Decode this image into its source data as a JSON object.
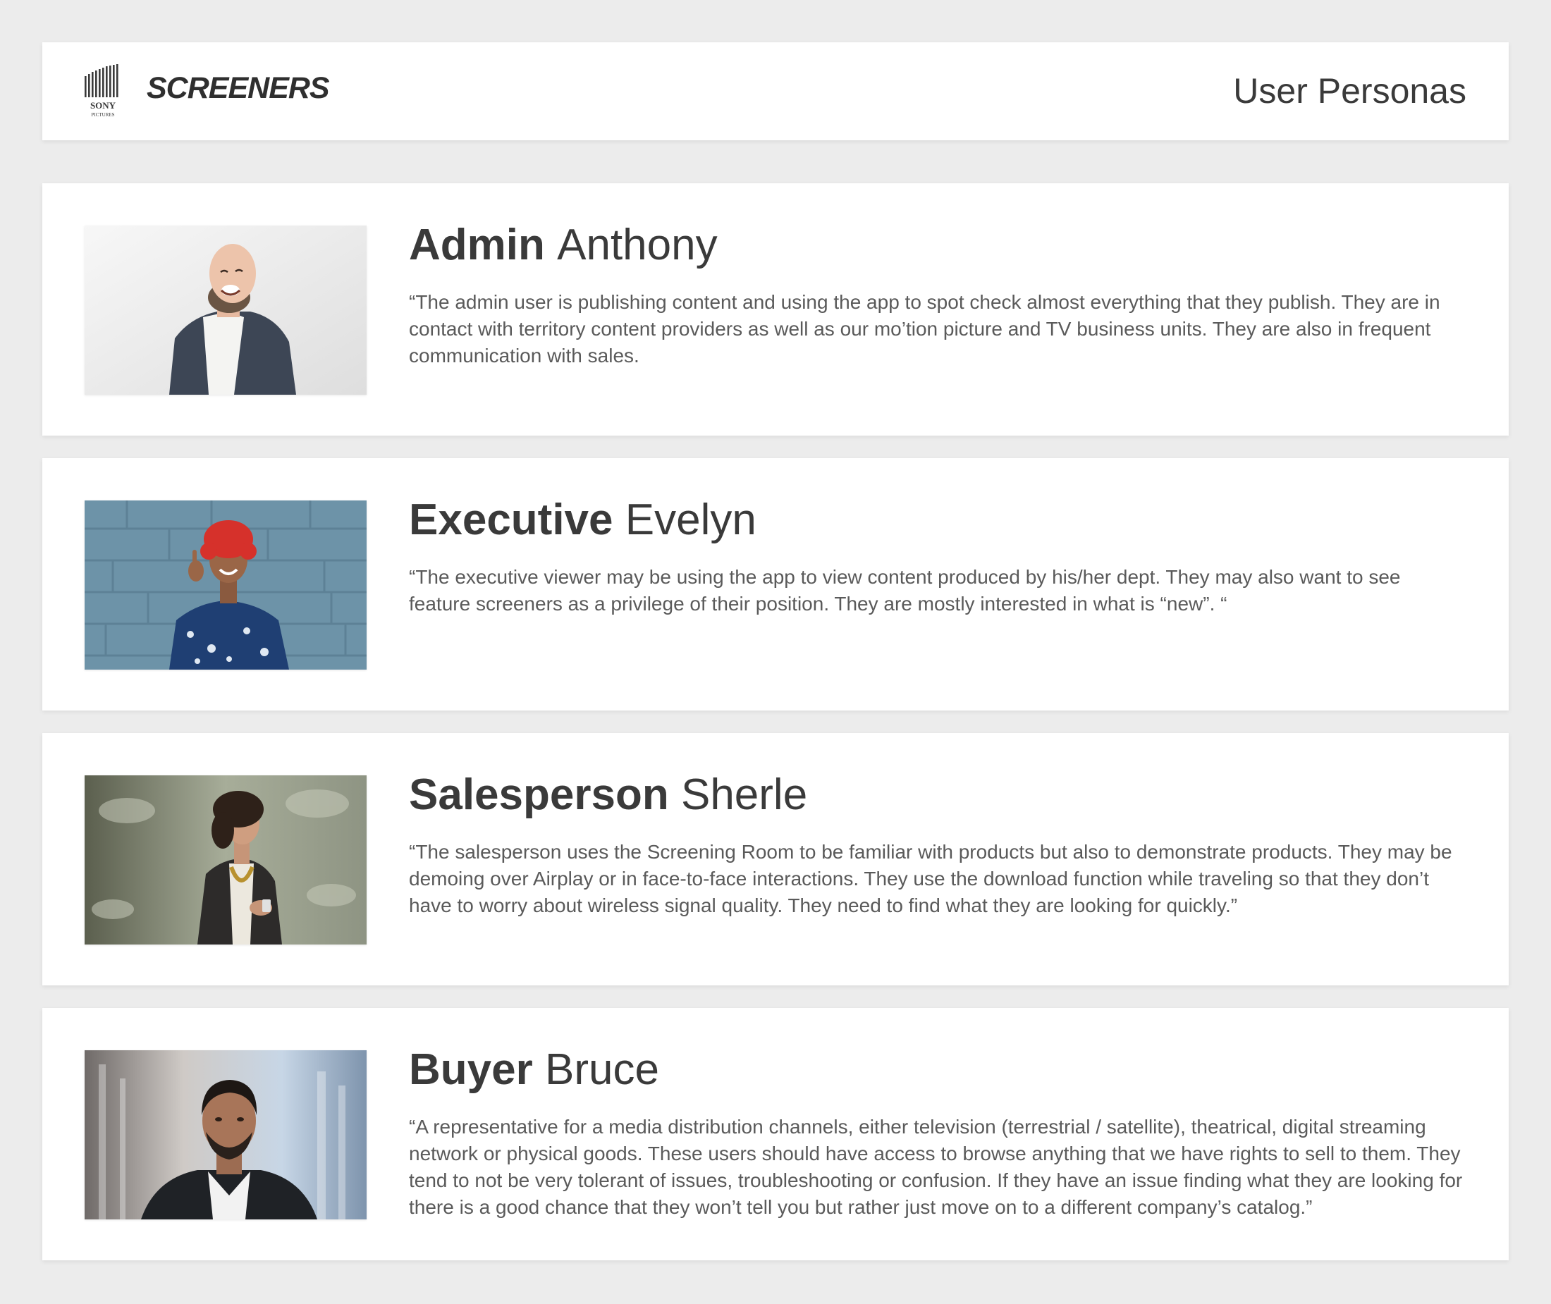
{
  "header": {
    "logo_text": "SONY PICTURES",
    "brand": "SCREENERS",
    "title": "User Personas"
  },
  "personas": [
    {
      "role": "Admin",
      "name": "Anthony",
      "quote": "“The admin user is publishing content and using the app to spot check almost everything that they publish.  They are in contact with territory content providers as well as our mo’tion picture and TV business units.  They are also in frequent communication with sales."
    },
    {
      "role": "Executive",
      "name": "Evelyn",
      "quote": "“The executive viewer may be using the app to view content produced by his/her dept.  They may also want to see feature screeners as a privilege of their position.  They are mostly interested in what is “new”. “"
    },
    {
      "role": "Salesperson",
      "name": "Sherle",
      "quote": "“The salesperson uses the Screening Room to be familiar with products but also to demonstrate products. They may be demoing over Airplay or in face-to-face interactions. They use the download function while traveling so that they don’t have to worry about wireless signal quality. They need to find what they are looking for quickly.”"
    },
    {
      "role": "Buyer",
      "name": "Bruce",
      "quote": "“A representative for a media distribution channels, either television (terrestrial / satellite), theatrical, digital streaming network or physical goods. These users should have access to browse anything that we have rights to sell to them. They tend to not be very tolerant of issues, troubleshooting or confusion.  If they have an issue finding what they are looking for there is a good chance that they won’t tell you but rather just move on to a different company’s catalog.”"
    }
  ]
}
